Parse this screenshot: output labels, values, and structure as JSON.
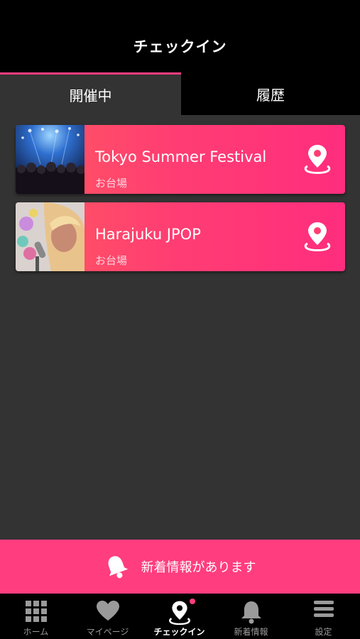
{
  "header": {
    "title": "チェックイン"
  },
  "tabs": [
    {
      "label": "開催中",
      "active": true
    },
    {
      "label": "履歴",
      "active": false
    }
  ],
  "events": [
    {
      "title": "Tokyo Summer Festival",
      "venue": "お台場",
      "image": "concert-crowd-photo"
    },
    {
      "title": "Harajuku JPOP",
      "venue": "お台場",
      "image": "singer-microphone-photo"
    }
  ],
  "notification": {
    "text": "新着情報があります"
  },
  "tabbar": [
    {
      "label": "ホーム",
      "icon": "grid-icon"
    },
    {
      "label": "マイページ",
      "icon": "heart-icon"
    },
    {
      "label": "チェックイン",
      "icon": "map-pin-icon",
      "active": true
    },
    {
      "label": "新着情報",
      "icon": "bell-icon"
    },
    {
      "label": "設定",
      "icon": "menu-icon"
    }
  ],
  "colors": {
    "accent": "#ff3d7f",
    "background": "#333333",
    "bar": "#000000"
  }
}
